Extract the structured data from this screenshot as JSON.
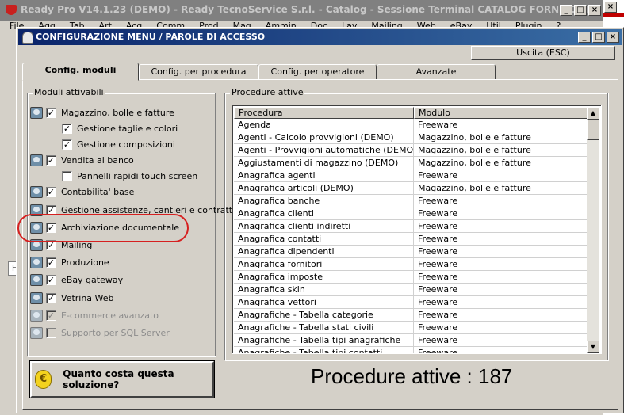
{
  "parent_window": {
    "title": "Ready Pro V14.1.23 (DEMO) - Ready TecnoService S.r.l. - Catalog - Sessione Terminal CATALOG FORNITORI",
    "menu": [
      "File",
      "Agg",
      "Tab",
      "Art",
      "Acq",
      "Comm",
      "Prod",
      "Mag",
      "Ammin",
      "Doc",
      "Lav",
      "Mailing",
      "Web",
      "eBay",
      "Util",
      "Plugin",
      "?"
    ],
    "peek_letter": "F"
  },
  "dialog": {
    "title": "CONFIGURAZIONE MENU / PAROLE DI ACCESSO",
    "exit_label": "Uscita (ESC)",
    "tabs": [
      {
        "label": "Config. moduli",
        "active": true
      },
      {
        "label": "Config. per procedura",
        "active": false
      },
      {
        "label": "Config. per operatore",
        "active": false
      },
      {
        "label": "Avanzate",
        "active": false
      }
    ]
  },
  "modules": {
    "title": "Moduli attivabili",
    "items": [
      {
        "label": "Magazzino, bolle e fatture",
        "checked": true,
        "enabled": true,
        "sub": false,
        "icon": "module-icon"
      },
      {
        "label": "Gestione taglie e colori",
        "checked": true,
        "enabled": true,
        "sub": true
      },
      {
        "label": "Gestione composizioni",
        "checked": true,
        "enabled": true,
        "sub": true
      },
      {
        "label": "Vendita al banco",
        "checked": true,
        "enabled": true,
        "sub": false,
        "icon": "module-icon"
      },
      {
        "label": "Pannelli rapidi touch screen",
        "checked": false,
        "enabled": true,
        "sub": true
      },
      {
        "label": "Contabilita' base",
        "checked": true,
        "enabled": true,
        "sub": false,
        "icon": "module-icon"
      },
      {
        "label": "Gestione assistenze, cantieri e contratti",
        "checked": true,
        "enabled": true,
        "sub": false,
        "icon": "module-icon"
      },
      {
        "label": "Archiviazione documentale",
        "checked": true,
        "enabled": true,
        "sub": false,
        "icon": "module-icon"
      },
      {
        "label": "Mailing",
        "checked": true,
        "enabled": true,
        "sub": false,
        "icon": "module-icon"
      },
      {
        "label": "Produzione",
        "checked": true,
        "enabled": true,
        "sub": false,
        "icon": "module-icon"
      },
      {
        "label": "eBay gateway",
        "checked": true,
        "enabled": true,
        "sub": false,
        "icon": "module-icon"
      },
      {
        "label": "Vetrina Web",
        "checked": true,
        "enabled": true,
        "sub": false,
        "icon": "module-icon"
      },
      {
        "label": "E-commerce avanzato",
        "checked": true,
        "enabled": false,
        "sub": false,
        "icon": "module-icon"
      },
      {
        "label": "Supporto per SQL Server",
        "checked": false,
        "enabled": false,
        "sub": false,
        "icon": "module-icon"
      }
    ],
    "price_button": "Quanto costa questa soluzione?",
    "price_icon": "coin-icon",
    "highlight_color": "#d62020"
  },
  "procedures": {
    "title": "Procedure attive",
    "columns": [
      "Procedura",
      "Modulo"
    ],
    "rows": [
      [
        "Agenda",
        "Freeware"
      ],
      [
        "Agenti - Calcolo provvigioni (DEMO)",
        "Magazzino, bolle e fatture"
      ],
      [
        "Agenti - Provvigioni automatiche (DEMO)",
        "Magazzino, bolle e fatture"
      ],
      [
        "Aggiustamenti di magazzino (DEMO)",
        "Magazzino, bolle e fatture"
      ],
      [
        "Anagrafica agenti",
        "Freeware"
      ],
      [
        "Anagrafica articoli (DEMO)",
        "Magazzino, bolle e fatture"
      ],
      [
        "Anagrafica banche",
        "Freeware"
      ],
      [
        "Anagrafica clienti",
        "Freeware"
      ],
      [
        "Anagrafica clienti indiretti",
        "Freeware"
      ],
      [
        "Anagrafica contatti",
        "Freeware"
      ],
      [
        "Anagrafica dipendenti",
        "Freeware"
      ],
      [
        "Anagrafica fornitori",
        "Freeware"
      ],
      [
        "Anagrafica imposte",
        "Freeware"
      ],
      [
        "Anagrafica skin",
        "Freeware"
      ],
      [
        "Anagrafica vettori",
        "Freeware"
      ],
      [
        "Anagrafiche - Tabella categorie",
        "Freeware"
      ],
      [
        "Anagrafiche - Tabella stati civili",
        "Freeware"
      ],
      [
        "Anagrafiche - Tabella tipi anagrafiche",
        "Freeware"
      ],
      [
        "Anagrafiche - Tabella tipi contatti",
        "Freeware"
      ]
    ],
    "count_text": "Procedure attive : 187"
  }
}
